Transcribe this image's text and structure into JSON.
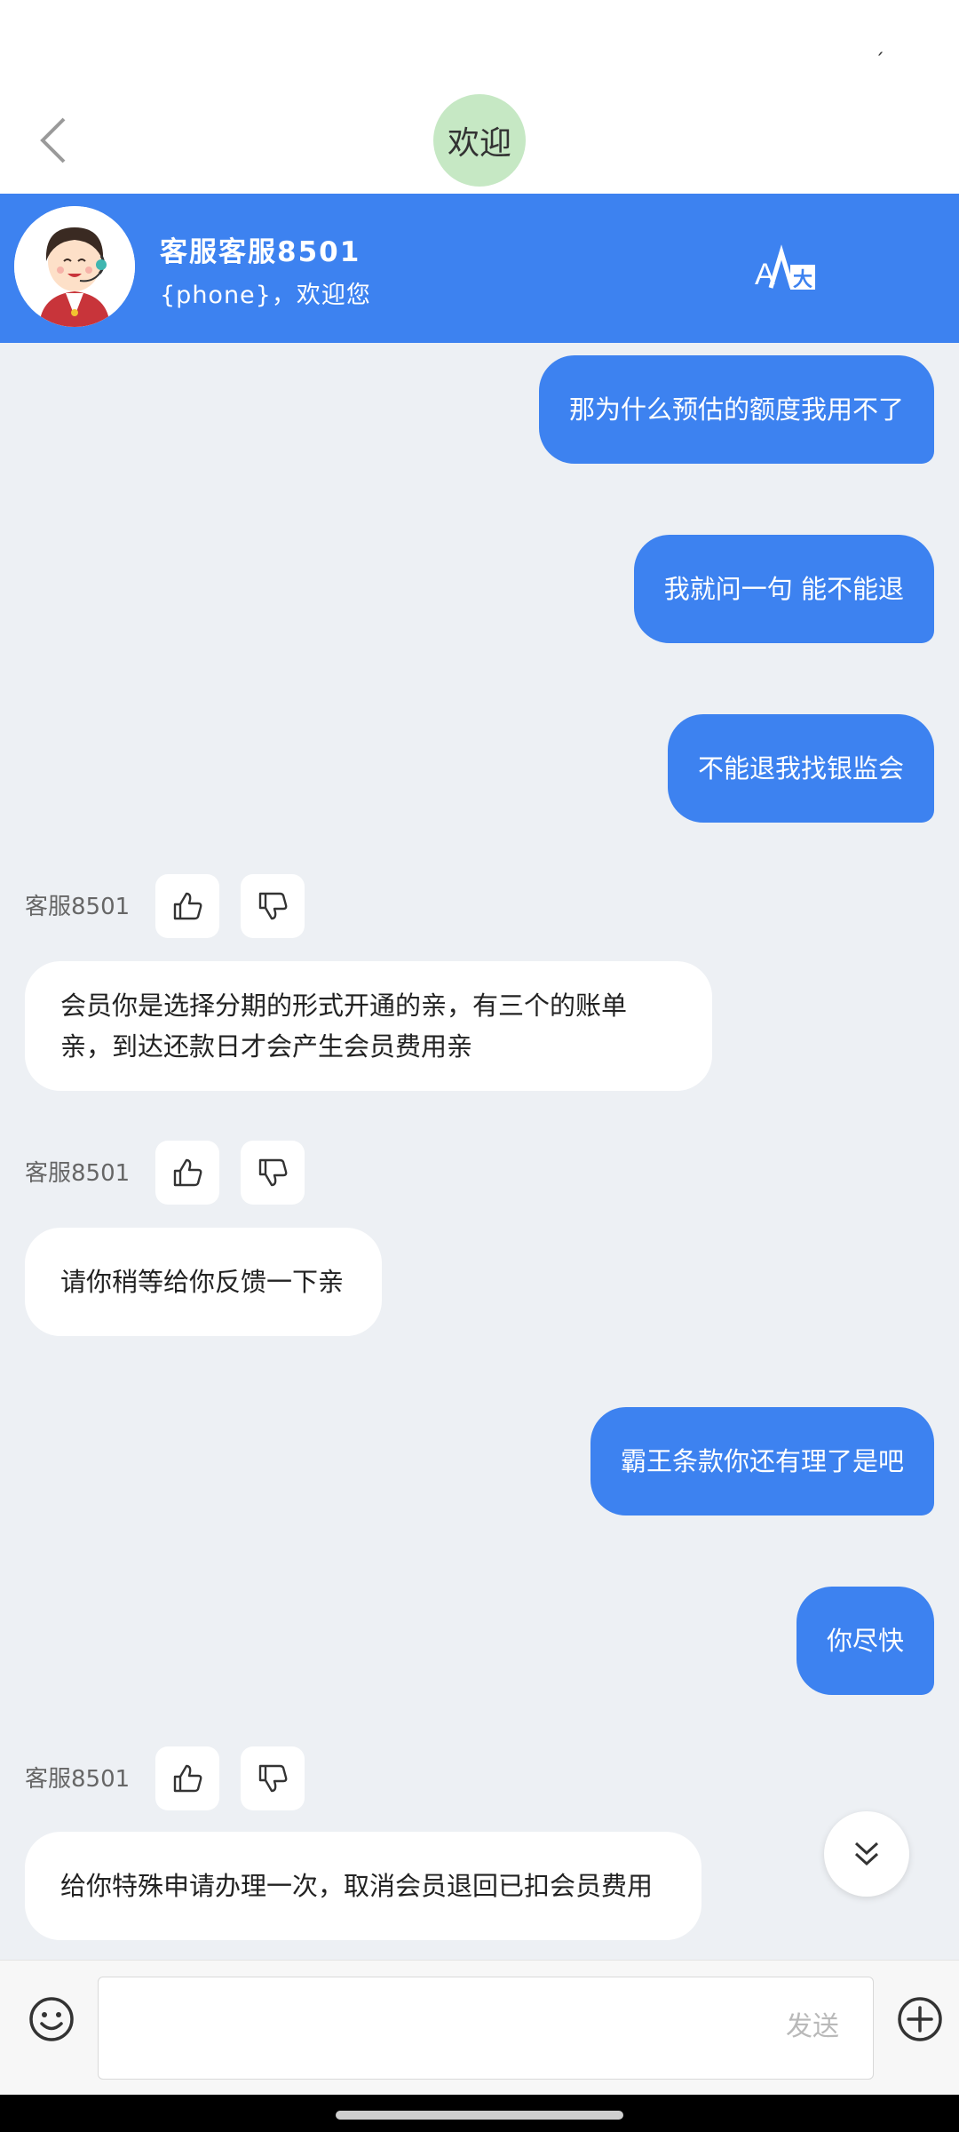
{
  "status_bar": {
    "mark": "ˏ"
  },
  "nav": {
    "title": "欢迎"
  },
  "agent": {
    "name": "客服客服8501",
    "subtitle": "{phone}，欢迎您"
  },
  "messages": [
    {
      "from": "user",
      "text": "那为什么预估的额度我用不了"
    },
    {
      "from": "user",
      "text": "我就问一句 能不能退"
    },
    {
      "from": "user",
      "text": "不能退我找银监会"
    },
    {
      "from": "agent",
      "label": "客服8501",
      "line1": "会员你是选择分期的形式开通的亲，有三个的账单",
      "line2": "亲，到达还款日才会产生会员费用亲"
    },
    {
      "from": "agent",
      "label": "客服8501",
      "text": "请你稍等给你反馈一下亲"
    },
    {
      "from": "user",
      "text": "霸王条款你还有理了是吧"
    },
    {
      "from": "user",
      "text": "你尽快"
    },
    {
      "from": "agent",
      "label": "客服8501",
      "text": "给你特殊申请办理一次，取消会员退回已扣会员费用"
    }
  ],
  "input": {
    "value": "",
    "send_label": "发送"
  },
  "icons": {
    "back": "chevron-left-icon",
    "translate": "translate-icon",
    "like": "thumbs-up-icon",
    "dislike": "thumbs-down-icon",
    "scroll_down": "double-chevron-down-icon",
    "emoji": "smiley-icon",
    "plus": "plus-circle-icon"
  },
  "colors": {
    "accent": "#3d82f0",
    "background": "#edf0f4",
    "bubble_in": "#ffffff"
  }
}
